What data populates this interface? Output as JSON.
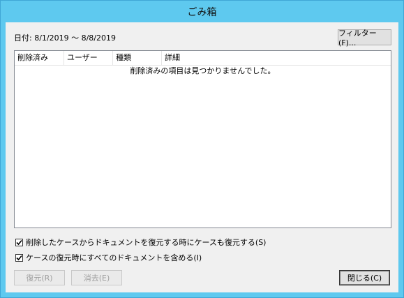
{
  "window": {
    "title": "ごみ箱"
  },
  "filter": {
    "date_range": "日付: 8/1/2019 〜 8/8/2019",
    "filter_button": "フィルター(F)..."
  },
  "list": {
    "columns": [
      "削除済み",
      "ユーザー",
      "種類",
      "詳細"
    ],
    "empty_message": "削除済みの項目は見つかりませんでした。"
  },
  "options": [
    {
      "label": "削除したケースからドキュメントを復元する時にケースも復元する(S)",
      "checked": true
    },
    {
      "label": "ケースの復元時にすべてのドキュメントを含める(I)",
      "checked": true
    }
  ],
  "buttons": {
    "restore": "復元(R)",
    "delete": "消去(E)",
    "close": "閉じる(C)"
  }
}
